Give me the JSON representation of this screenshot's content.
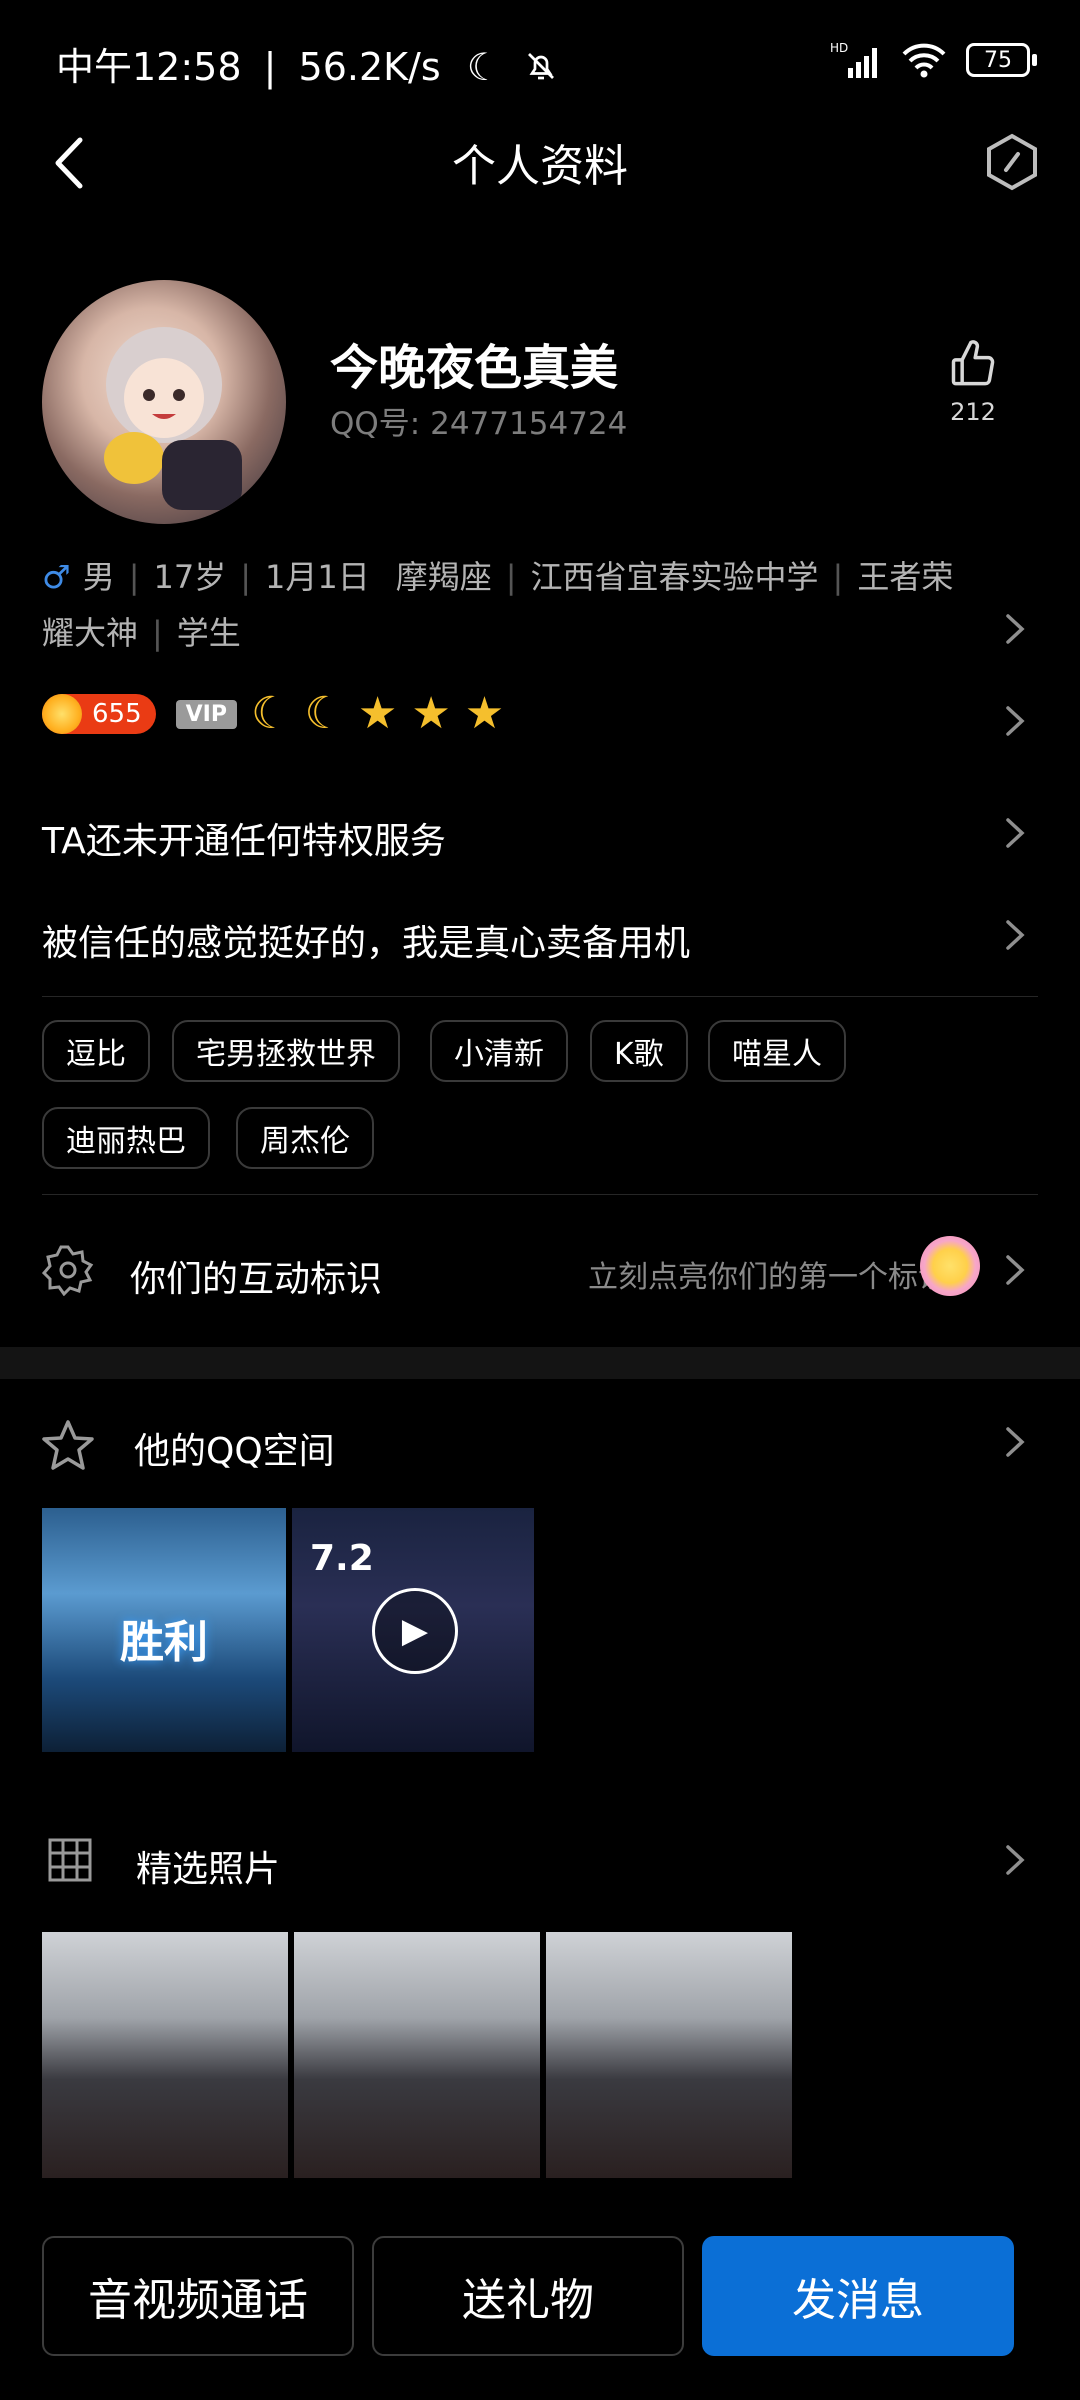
{
  "status_bar": {
    "time": "中午12:58",
    "speed": "56.2K/s",
    "battery": "75"
  },
  "nav": {
    "title": "个人资料"
  },
  "profile": {
    "nickname": "今晚夜色真美",
    "qq_label": "QQ号: 2477154724",
    "like_count": "212",
    "gender": "男",
    "age": "17岁",
    "birthday": "1月1日",
    "zodiac": "摩羯座",
    "school": "江西省宜春实验中学",
    "title_part1": "王者荣",
    "title_part2": "耀大神",
    "occupation": "学生"
  },
  "badges": {
    "sun_level": "655",
    "vip": "VIP"
  },
  "privilege_text": "TA还未开通任何特权服务",
  "signature": "被信任的感觉挺好的，我是真心卖备用机",
  "tags": [
    "逗比",
    "宅男拯救世界",
    "小清新",
    "K歌",
    "喵星人",
    "迪丽热巴",
    "周杰伦"
  ],
  "interaction": {
    "title": "你们的互动标识",
    "hint": "立刻点亮你们的第一个标识"
  },
  "qzone": {
    "title": "他的QQ空间",
    "thumb1_text": "胜利",
    "thumb2_text": "7.2"
  },
  "photos": {
    "title": "精选照片"
  },
  "actions": {
    "call": "音视频通话",
    "gift": "送礼物",
    "message": "发消息"
  }
}
